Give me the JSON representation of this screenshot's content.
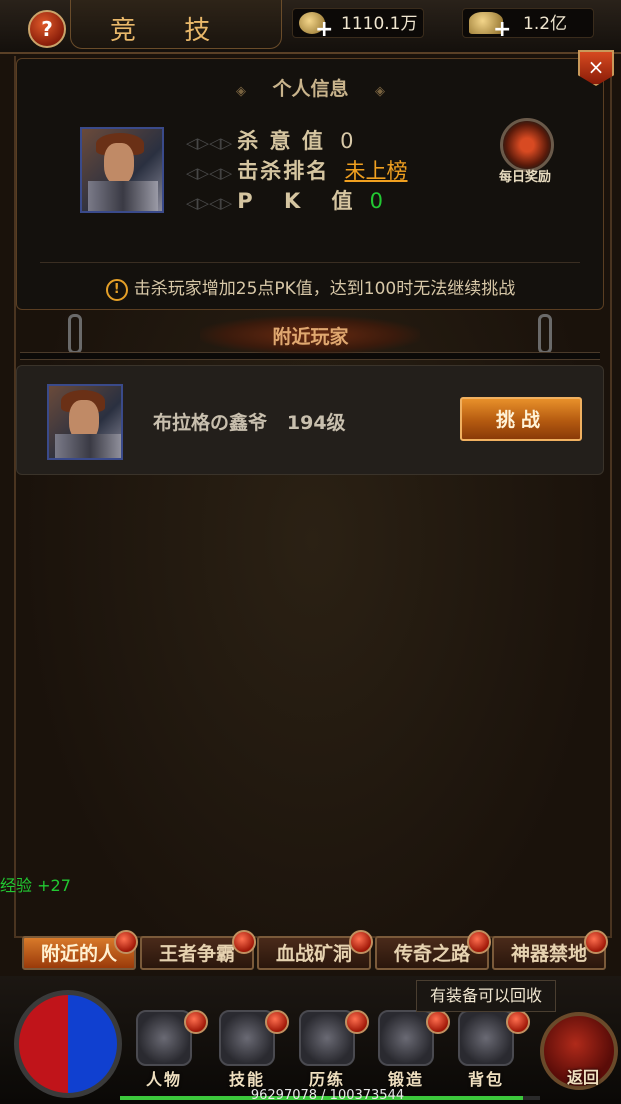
{
  "header": {
    "title": "竞 技",
    "help_symbol": "?",
    "coins": "1110.1万",
    "ingots": "1.2亿"
  },
  "info": {
    "title": "个人信息",
    "close_symbol": "×",
    "stats": [
      {
        "label": "杀 意 值",
        "value": "0",
        "color": "#d8c9a8"
      },
      {
        "label": "击杀排名",
        "value": "未上榜",
        "color": "#f0a020"
      },
      {
        "label": "P K 值",
        "value": "0",
        "color": "#22c832"
      }
    ],
    "reward_label": "每日奖励",
    "notice": "击杀玩家增加25点PK值，达到100时无法继续挑战",
    "notice_symbol": "!"
  },
  "nearby": {
    "title": "附近玩家",
    "players": [
      {
        "name": "布拉格の鑫爷",
        "level": "194级",
        "action": "挑战"
      }
    ]
  },
  "log": {
    "label": "经验",
    "value": "+27"
  },
  "tabs": [
    {
      "label": "附近的人",
      "active": true
    },
    {
      "label": "王者争霸",
      "active": false
    },
    {
      "label": "血战矿洞",
      "active": false
    },
    {
      "label": "传奇之路",
      "active": false
    },
    {
      "label": "神器禁地",
      "active": false
    }
  ],
  "nav": [
    {
      "label": "人物",
      "icon": "character-icon"
    },
    {
      "label": "技能",
      "icon": "skill-book-icon"
    },
    {
      "label": "历练",
      "icon": "training-icon"
    },
    {
      "label": "锻造",
      "icon": "forge-icon"
    },
    {
      "label": "背包",
      "icon": "bag-icon"
    }
  ],
  "recycle_tip": "有装备可以回收",
  "back_label": "返回",
  "exp": {
    "current": 96297078,
    "max": 100373544,
    "text": "96297078 / 100373544"
  },
  "colors": {
    "accent": "#e8902a",
    "exp_green": "#22c832",
    "rank_orange": "#f0a020"
  }
}
